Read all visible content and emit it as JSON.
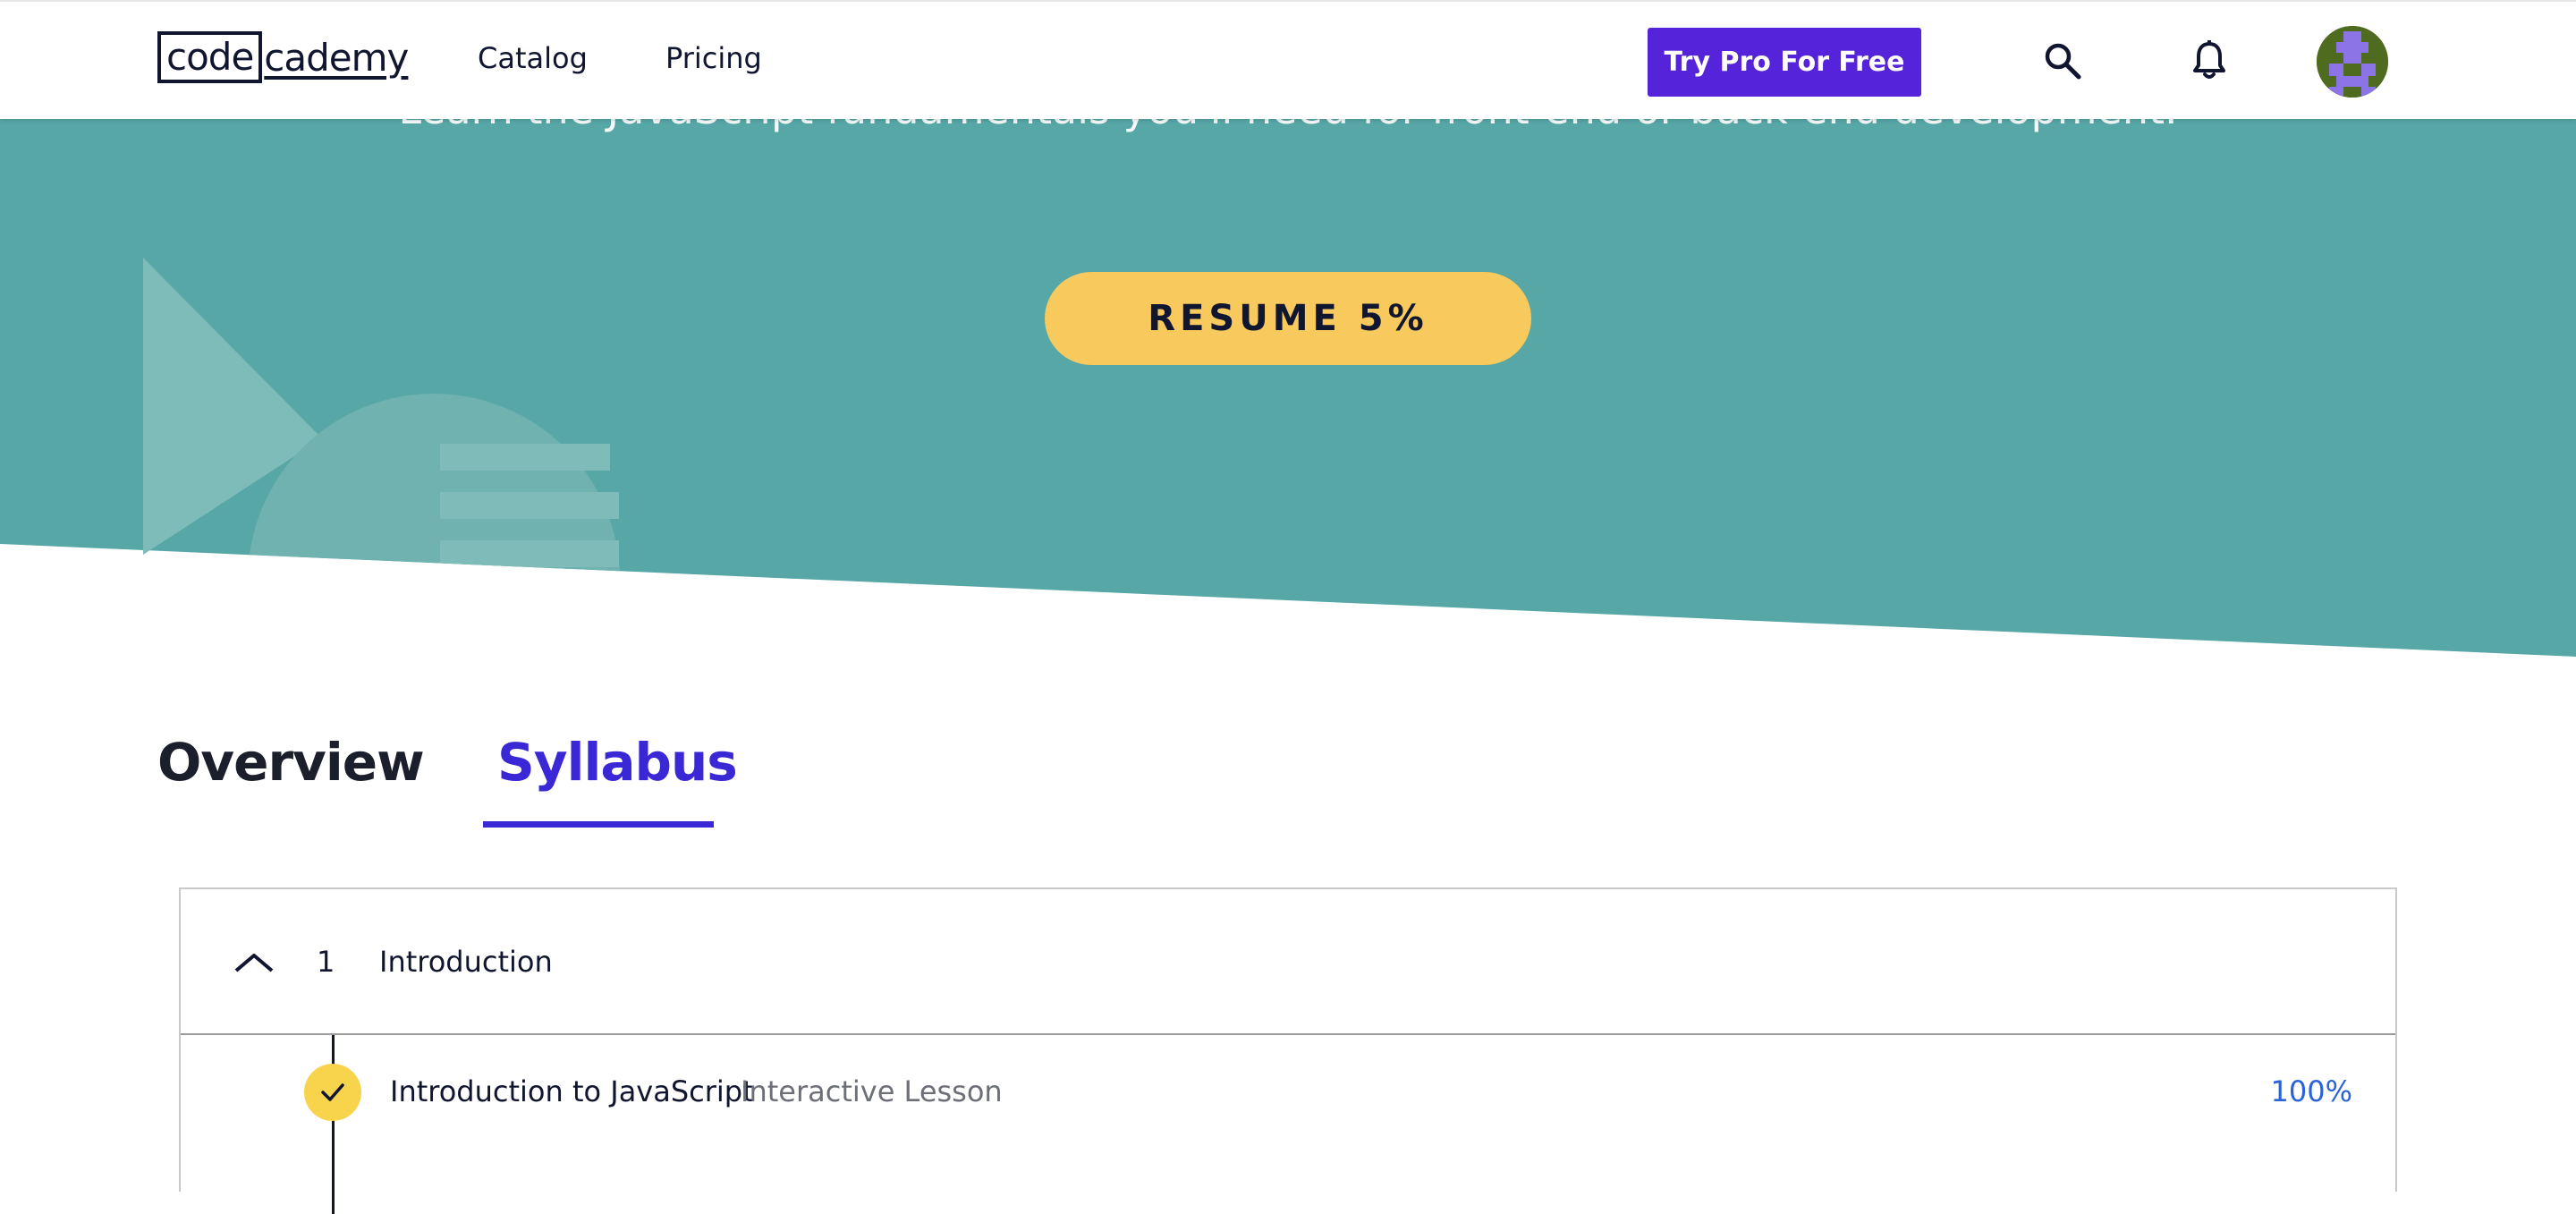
{
  "header": {
    "logo_code": "code",
    "logo_rest": "cademy",
    "nav": {
      "catalog": "Catalog",
      "pricing": "Pricing"
    },
    "try_pro_label": "Try Pro For Free",
    "icons": {
      "search": "search-icon",
      "notifications": "bell-icon",
      "avatar": "avatar"
    }
  },
  "hero": {
    "subtitle": "Learn the JavaScript fundamentals you'll need for front-end or back-end development.",
    "resume_label": "RESUME 5%"
  },
  "tabs": [
    {
      "label": "Overview",
      "active": false
    },
    {
      "label": "Syllabus",
      "active": true
    }
  ],
  "syllabus": {
    "modules": [
      {
        "number": "1",
        "title": "Introduction",
        "expanded": true,
        "lessons": [
          {
            "title": "Introduction to JavaScript",
            "type": "Interactive Lesson",
            "progress": "100%",
            "completed": true
          }
        ]
      }
    ]
  },
  "colors": {
    "hero_teal": "#57a7a7",
    "resume_yellow": "#f8c95c",
    "pro_purple": "#5523d9",
    "tab_active": "#3a27d6",
    "progress_blue": "#2a62d9",
    "check_yellow": "#f8d34c"
  }
}
